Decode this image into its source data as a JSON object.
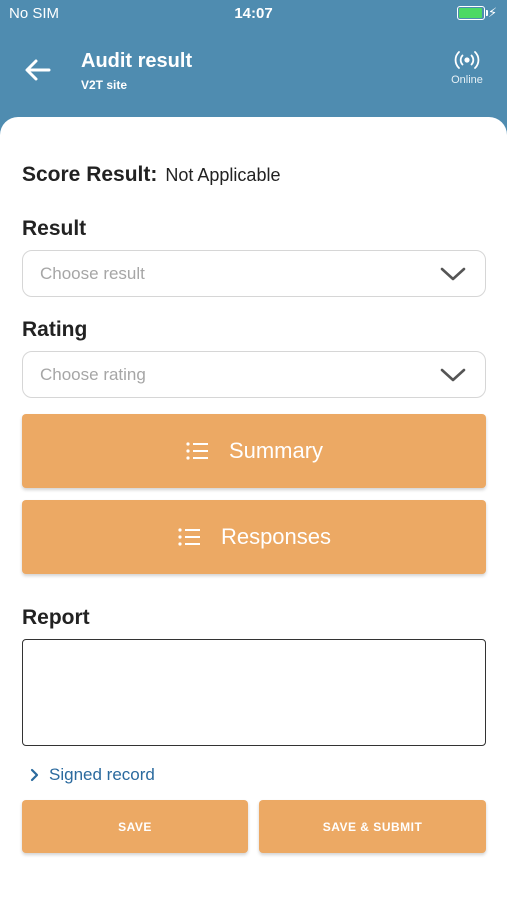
{
  "status_bar": {
    "carrier": "No SIM",
    "time": "14:07"
  },
  "header": {
    "title": "Audit result",
    "subtitle": "V2T site",
    "connection_status": "Online"
  },
  "score": {
    "label": "Score Result:",
    "value": "Not Applicable"
  },
  "result": {
    "label": "Result",
    "placeholder": "Choose result"
  },
  "rating": {
    "label": "Rating",
    "placeholder": "Choose rating"
  },
  "actions": {
    "summary_label": "Summary",
    "responses_label": "Responses"
  },
  "report": {
    "label": "Report",
    "value": ""
  },
  "signed_record": {
    "label": "Signed record"
  },
  "footer": {
    "save_label": "SAVE",
    "save_submit_label": "SAVE & SUBMIT"
  },
  "colors": {
    "header_bg": "#4f8cb0",
    "accent_orange": "#eca964",
    "link_blue": "#2b6a9e",
    "battery_green": "#4cd964"
  }
}
